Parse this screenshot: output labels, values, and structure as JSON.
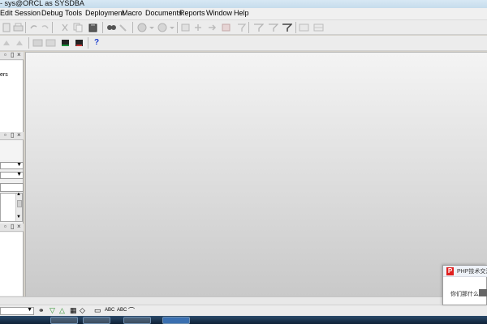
{
  "window": {
    "title": "- sys@ORCL as SYSDBA"
  },
  "menu": [
    "Edit",
    "Session",
    "Debug",
    "Tools",
    "Deployment",
    "Macro",
    "Documents",
    "Reports",
    "Window",
    "Help"
  ],
  "toolbar2": {
    "help_label": "?"
  },
  "left_panel": {
    "pane1": {
      "item_text": "ers"
    },
    "controls": {
      "pin": "ᵖ",
      "close": "×"
    }
  },
  "bottom_toolbar": {
    "labels": [
      "ABC",
      "ABC"
    ]
  },
  "popup": {
    "title": "PHP技术交流",
    "message": "你们那什么情"
  },
  "colors": {
    "mdi_background": "#d9d9d9",
    "popup_logo": "#e02020",
    "taskbar": "#1a3450"
  }
}
